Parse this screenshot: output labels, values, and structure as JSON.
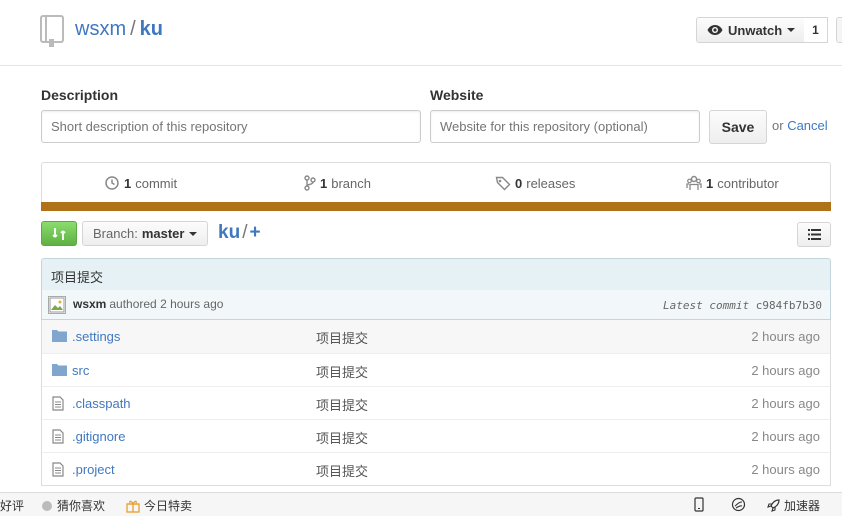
{
  "repo": {
    "owner": "wsxm",
    "separator": "/",
    "name": "ku"
  },
  "watch": {
    "label": "Unwatch",
    "count": "1"
  },
  "form": {
    "description_label": "Description",
    "description_placeholder": "Short description of this repository",
    "website_label": "Website",
    "website_placeholder": "Website for this repository (optional)",
    "save_label": "Save",
    "or_text": "or",
    "cancel_label": "Cancel"
  },
  "summary": {
    "commits": {
      "count": "1",
      "label": "commit"
    },
    "branches": {
      "count": "1",
      "label": "branch"
    },
    "releases": {
      "count": "0",
      "label": "releases"
    },
    "contributors": {
      "count": "1",
      "label": "contributor"
    },
    "language_color": "#b07219"
  },
  "nav": {
    "branch_prefix": "Branch:",
    "branch_name": "master",
    "breadcrumb_root": "ku",
    "breadcrumb_sep": "/",
    "add_symbol": "+"
  },
  "commit": {
    "message": "项目提交",
    "author": "wsxm",
    "authored": "authored 2 hours ago",
    "latest_label": "Latest commit",
    "sha": "c984fb7b30"
  },
  "files": [
    {
      "type": "directory",
      "name": ".settings",
      "message": "项目提交",
      "age": "2 hours ago"
    },
    {
      "type": "directory",
      "name": "src",
      "message": "项目提交",
      "age": "2 hours ago"
    },
    {
      "type": "file",
      "name": ".classpath",
      "message": "项目提交",
      "age": "2 hours ago"
    },
    {
      "type": "file",
      "name": ".gitignore",
      "message": "项目提交",
      "age": "2 hours ago"
    },
    {
      "type": "file",
      "name": ".project",
      "message": "项目提交",
      "age": "2 hours ago"
    }
  ],
  "statusbar": {
    "item1": "好评",
    "item2": "猜你喜欢",
    "item3": "今日特卖",
    "item4": "加速器"
  }
}
